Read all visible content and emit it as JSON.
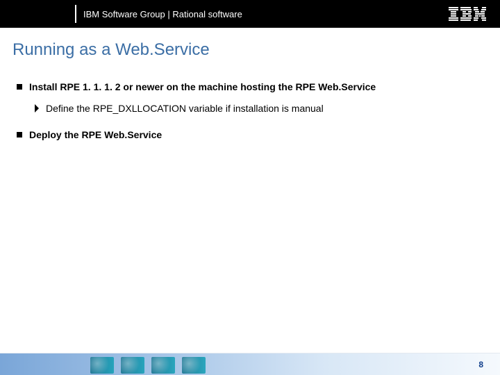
{
  "header": {
    "text": "IBM Software Group | Rational software",
    "logo_label": "IBM"
  },
  "title": "Running as a Web.Service",
  "body": {
    "items": [
      {
        "text": "Install RPE 1. 1. 1. 2 or newer on the machine hosting the RPE Web.Service",
        "sub": [
          "Define the RPE_DXLLOCATION variable if installation is manual"
        ]
      },
      {
        "text": "Deploy the RPE Web.Service",
        "sub": []
      }
    ]
  },
  "footer": {
    "page_number": "8"
  }
}
